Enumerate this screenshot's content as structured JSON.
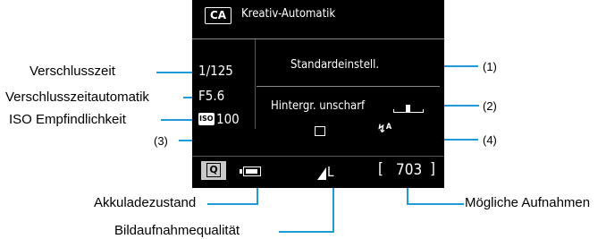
{
  "screen": {
    "mode_badge": "CA",
    "mode_title": "Kreativ-Automatik",
    "shutter_speed": "1/125",
    "aperture": "F5.6",
    "iso_label": "ISO",
    "iso_value": "100",
    "ambience": "Standardeinstell.",
    "background_blur": "Hintergr. unscharf",
    "drive_icon": "single-shot-icon",
    "flash_icon": "flash-auto-icon",
    "flash_suffix": "A",
    "quick_button": "Q",
    "battery_icon": "battery-icon",
    "quality": "L",
    "shots_remaining": "703"
  },
  "callouts": {
    "shutter_speed": "Verschlusszeit",
    "shutter_auto": "Verschlusszeitautomatik",
    "iso": "ISO Empfindlichkeit",
    "drive": "(3)",
    "battery": "Akkuladezustand",
    "quality": "Bildaufnahmequalität",
    "shots": "Mögliche Aufnahmen",
    "ambience": "(1)",
    "blur": "(2)",
    "flash": "(4)"
  },
  "colors": {
    "callout_line": "#1f9bd6",
    "screen_bg": "#000000"
  }
}
